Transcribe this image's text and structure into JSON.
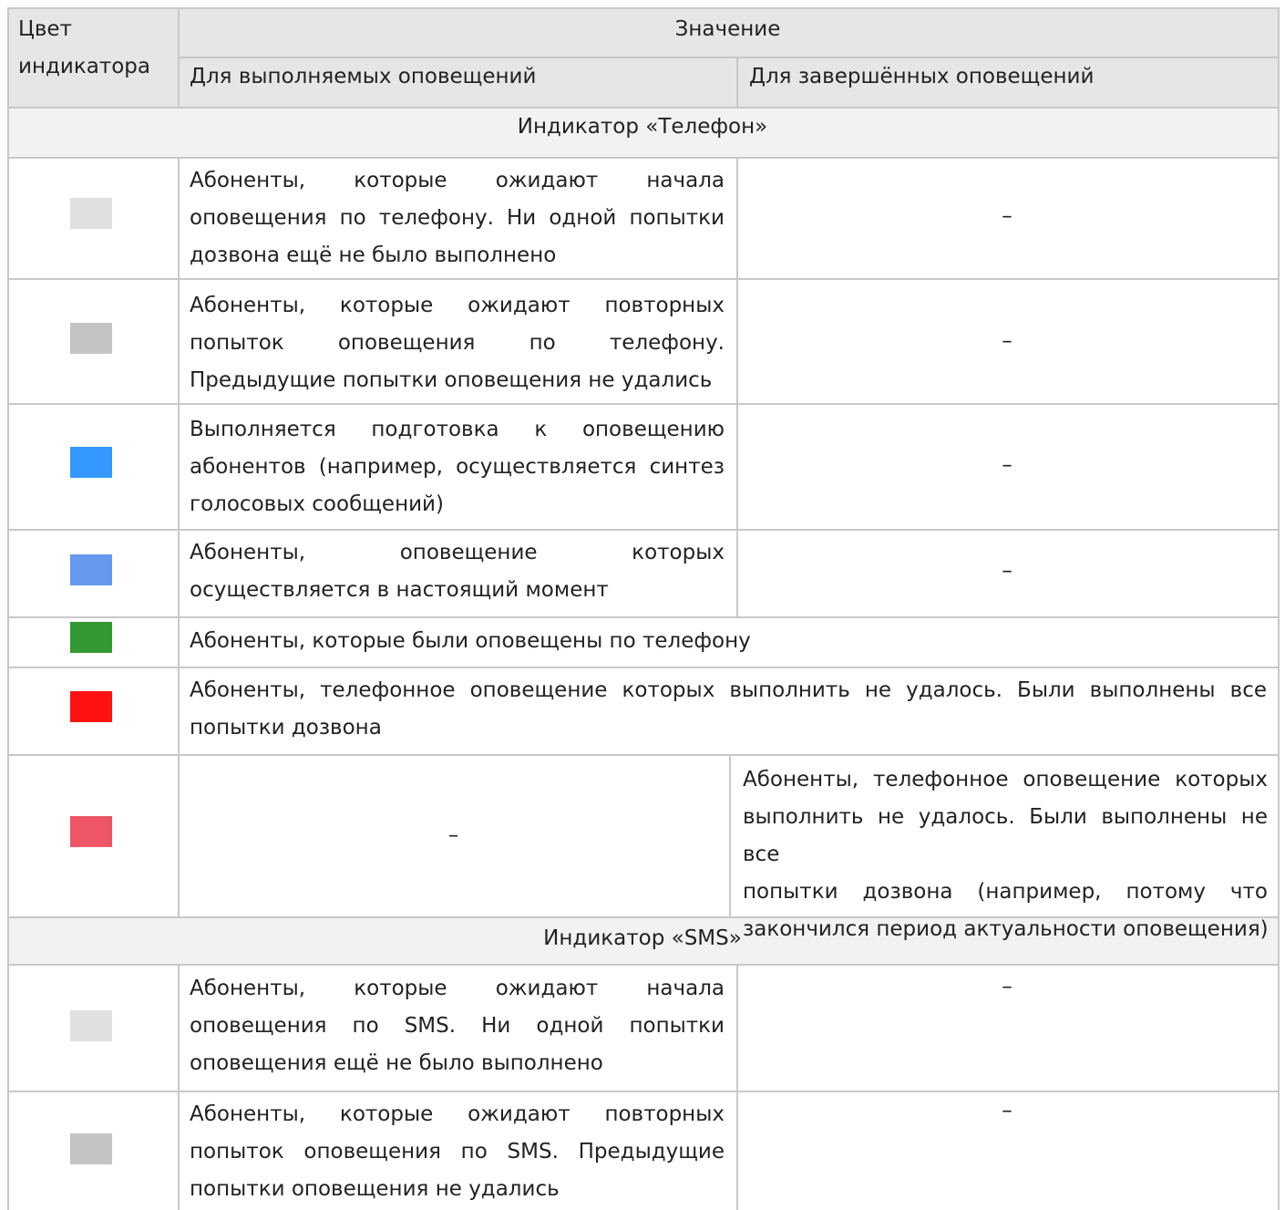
{
  "header": {
    "col_indicator": [
      "Цвет",
      "индикатора"
    ],
    "col_value": "Значение",
    "col_running": "Для выполняемых оповещений",
    "col_finished": "Для завершённых оповещений"
  },
  "sections": {
    "phone_title": "Индикатор «Телефон»",
    "sms_title": "Индикатор «SMS»"
  },
  "colors": {
    "header_bg": "#e6e6e6",
    "grid": "#c8c8c8",
    "text": "#222222"
  },
  "rows": [
    {
      "color": "#e0e0e0",
      "running": [
        "Абоненты, которые ожидают начала",
        "оповещения по телефону. Ни одной попытки",
        "дозвона ещё не было выполнено"
      ],
      "finished": "–"
    },
    {
      "color": "#c4c4c4",
      "running": [
        "Абоненты, которые ожидают повторных",
        "попыток оповещения по телефону.",
        "Предыдущие попытки оповещения не удались"
      ],
      "finished": "–"
    },
    {
      "color": "#3399ff",
      "running": [
        "Выполняется подготовка к оповещению",
        "абонентов (например, осуществляется синтез",
        "голосовых сообщений)"
      ],
      "finished": "–"
    },
    {
      "color": "#6699ee",
      "running": [
        "Абоненты, оповещение которых",
        "осуществляется в настоящий момент"
      ],
      "finished": "–"
    },
    {
      "color": "#339933",
      "both": [
        "Абоненты, которые были оповещены по телефону"
      ]
    },
    {
      "color": "#ff1111",
      "both": [
        "Абоненты, телефонное оповещение которых выполнить не удалось. Были выполнены все",
        "попытки дозвона"
      ]
    },
    {
      "color": "#ee5566",
      "running": "–",
      "finished": [
        "Абоненты, телефонное оповещение которых",
        "выполнить не удалось. Были выполнены не все",
        "попытки дозвона (например, потому что",
        "закончился период актуальности оповещения)"
      ]
    },
    {
      "color": "#e0e0e0",
      "running": [
        "Абоненты, которые ожидают начала",
        "оповещения по SMS. Ни одной попытки",
        "оповещения ещё не было выполнено"
      ],
      "finished": "–"
    },
    {
      "color": "#c4c4c4",
      "running": [
        "Абоненты, которые ожидают повторных",
        "попыток оповещения по SMS. Предыдущие",
        "попытки оповещения не удались"
      ],
      "finished": "–"
    }
  ]
}
